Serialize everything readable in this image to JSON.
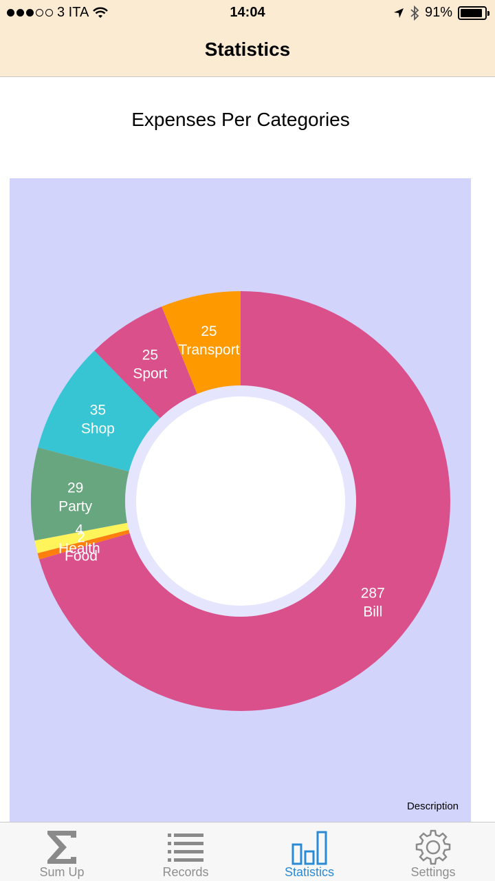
{
  "status_bar": {
    "carrier": "3 ITA",
    "time": "14:04",
    "battery": "91%"
  },
  "nav": {
    "title": "Statistics"
  },
  "chart_heading": "Expenses Per Categories",
  "chart_data": {
    "type": "pie",
    "donut": true,
    "title": "Expenses Per Categories",
    "description": "Description",
    "categories": [
      "Bill",
      "Food",
      "Health",
      "Party",
      "Shop",
      "Sport",
      "Transport"
    ],
    "values": [
      287,
      2,
      4,
      29,
      35,
      25,
      25
    ],
    "colors": [
      "#d9508a",
      "#ff7f0e",
      "#fff45a",
      "#68a67f",
      "#38c5d3",
      "#d9508a",
      "#ff9900"
    ]
  },
  "tabs": [
    {
      "label": "Sum Up",
      "icon": "sigma-icon",
      "active": false
    },
    {
      "label": "Records",
      "icon": "list-icon",
      "active": false
    },
    {
      "label": "Statistics",
      "icon": "bar-chart-icon",
      "active": true
    },
    {
      "label": "Settings",
      "icon": "gear-icon",
      "active": false
    }
  ]
}
